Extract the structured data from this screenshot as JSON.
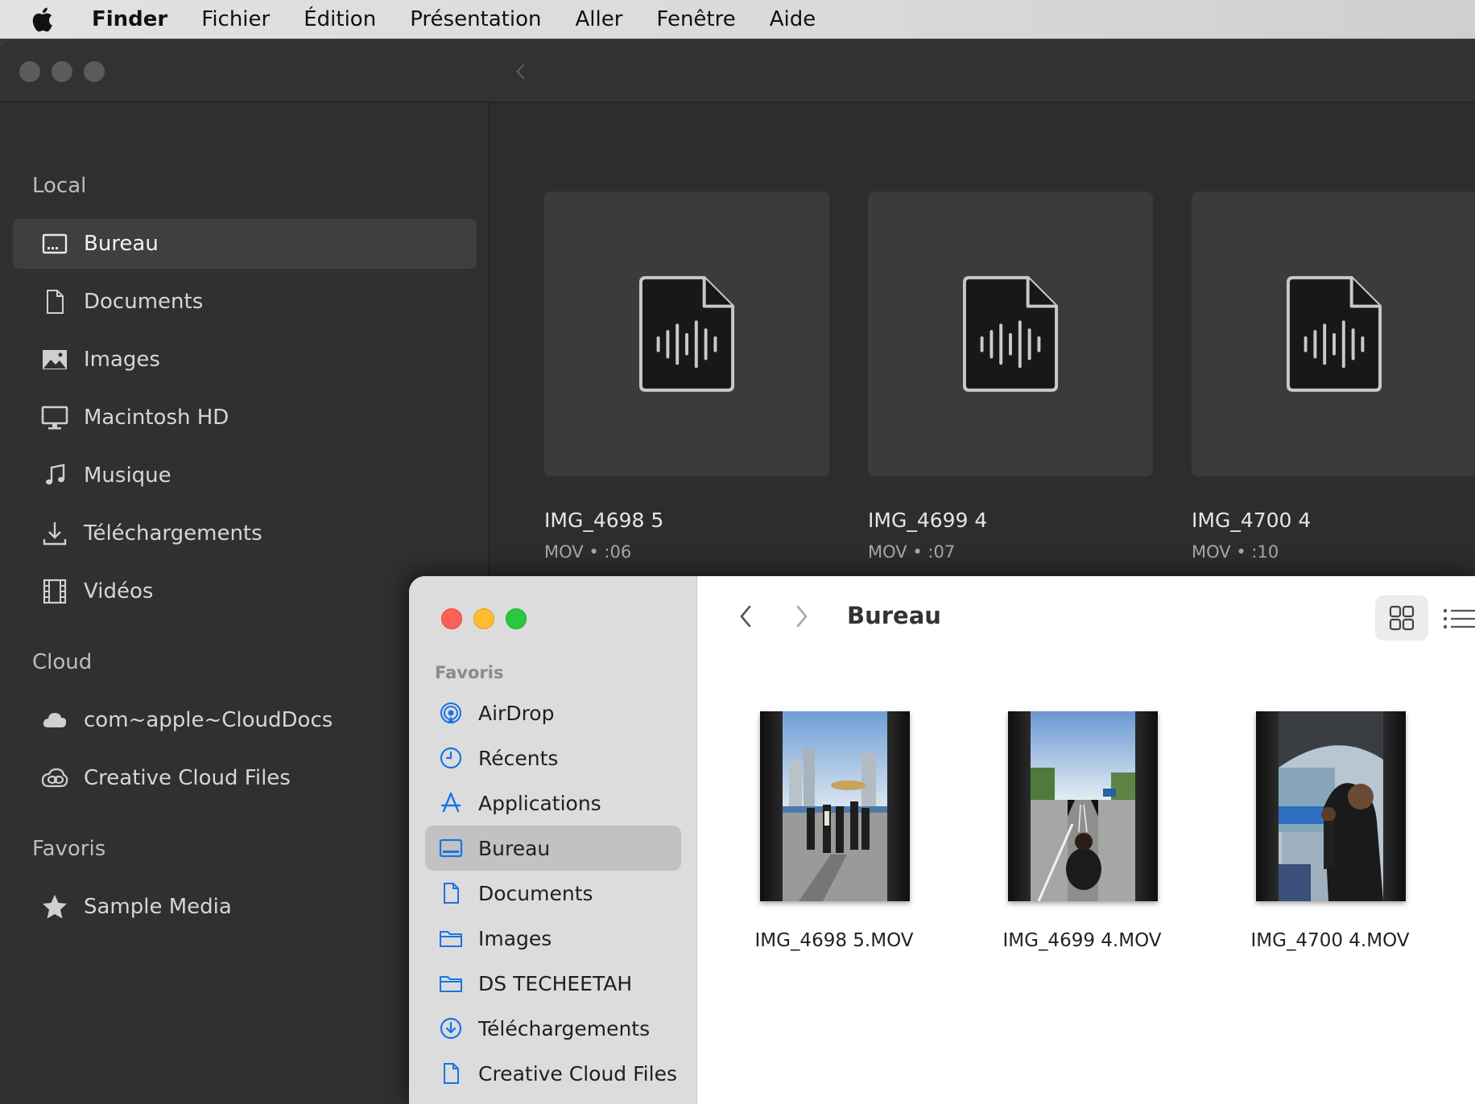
{
  "menubar": {
    "app_name": "Finder",
    "items": [
      "Fichier",
      "Édition",
      "Présentation",
      "Aller",
      "Fenêtre",
      "Aide"
    ]
  },
  "dark_window": {
    "sidebar": {
      "sections": [
        {
          "header": "Local",
          "items": [
            {
              "label": "Bureau",
              "icon": "desktop-icon",
              "selected": true
            },
            {
              "label": "Documents",
              "icon": "document-icon"
            },
            {
              "label": "Images",
              "icon": "image-icon"
            },
            {
              "label": "Macintosh HD",
              "icon": "monitor-icon"
            },
            {
              "label": "Musique",
              "icon": "music-note-icon"
            },
            {
              "label": "Téléchargements",
              "icon": "download-icon"
            },
            {
              "label": "Vidéos",
              "icon": "film-icon"
            }
          ]
        },
        {
          "header": "Cloud",
          "items": [
            {
              "label": "com~apple~CloudDocs",
              "icon": "cloud-icon"
            },
            {
              "label": "Creative Cloud Files",
              "icon": "creative-cloud-icon"
            }
          ]
        },
        {
          "header": "Favoris",
          "items": [
            {
              "label": "Sample Media",
              "icon": "star-icon"
            }
          ]
        }
      ]
    },
    "files": [
      {
        "name": "IMG_4698 5",
        "meta": "MOV • :06"
      },
      {
        "name": "IMG_4699 4",
        "meta": "MOV • :07"
      },
      {
        "name": "IMG_4700 4",
        "meta": "MOV • :10"
      }
    ]
  },
  "finder": {
    "title": "Bureau",
    "sidebar": {
      "section": "Favoris",
      "items": [
        {
          "label": "AirDrop",
          "icon": "airdrop-icon"
        },
        {
          "label": "Récents",
          "icon": "clock-icon"
        },
        {
          "label": "Applications",
          "icon": "applications-icon"
        },
        {
          "label": "Bureau",
          "icon": "desktop-icon",
          "selected": true
        },
        {
          "label": "Documents",
          "icon": "document-icon"
        },
        {
          "label": "Images",
          "icon": "folder-icon"
        },
        {
          "label": "DS TECHEETAH",
          "icon": "folder-icon"
        },
        {
          "label": "Téléchargements",
          "icon": "download-circle-icon"
        },
        {
          "label": "Creative Cloud Files",
          "icon": "document-icon"
        }
      ]
    },
    "files": [
      {
        "name": "IMG_4698 5.MOV"
      },
      {
        "name": "IMG_4699 4.MOV"
      },
      {
        "name": "IMG_4700 4.MOV"
      }
    ]
  },
  "colors": {
    "traffic_red": "#fe5f57",
    "traffic_yellow": "#febc2e",
    "traffic_green": "#28c840",
    "finder_accent": "#1a73e8"
  }
}
